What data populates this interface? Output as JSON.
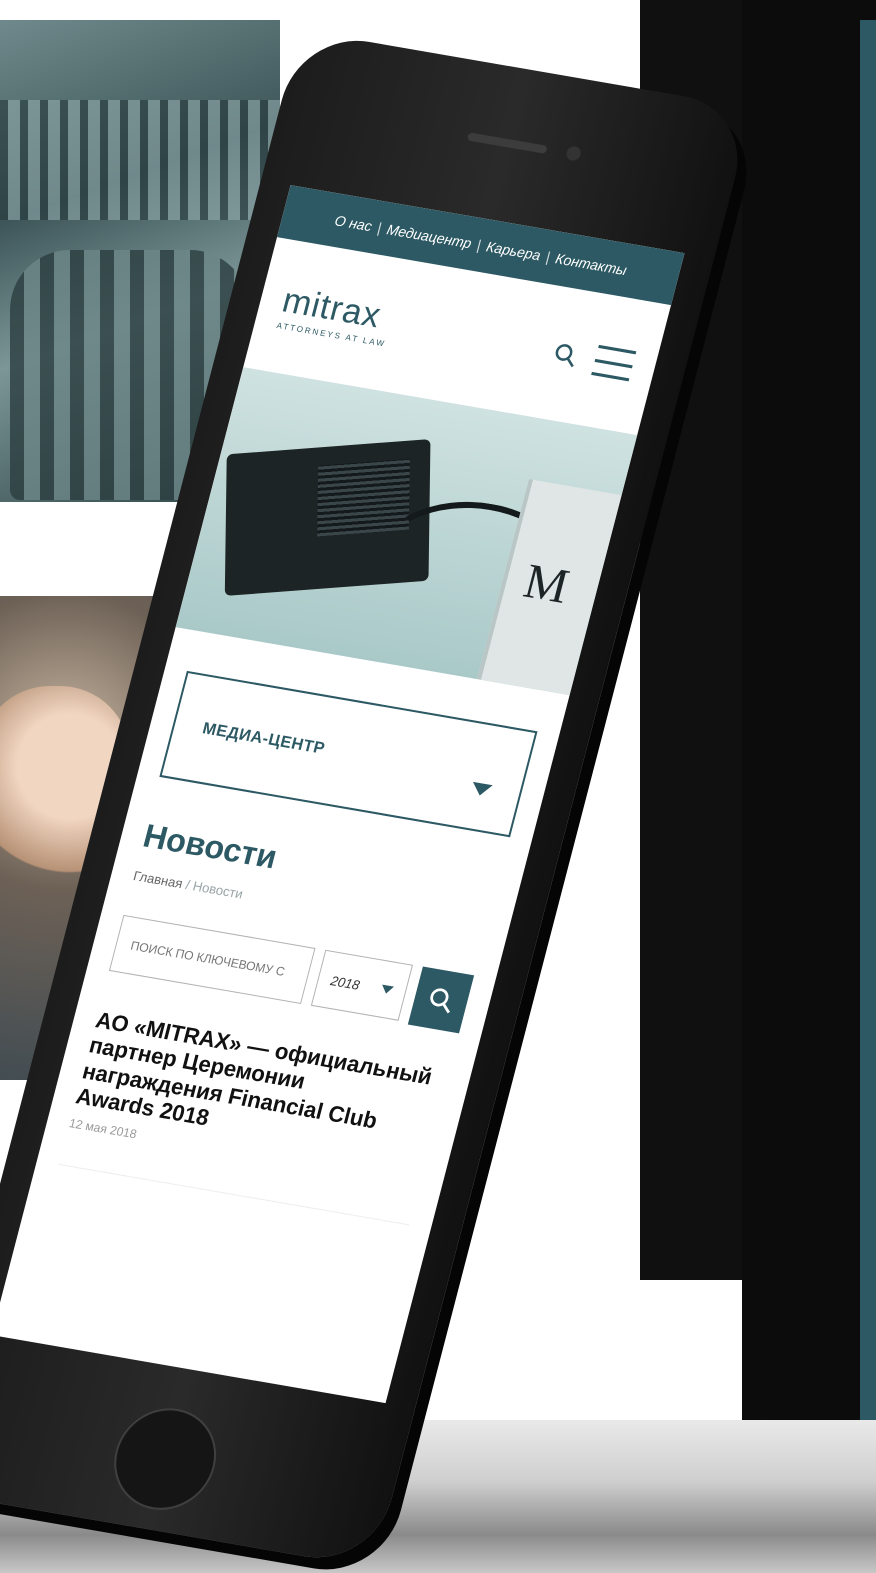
{
  "topnav": {
    "items": [
      "О нас",
      "Медиацентр",
      "Карьера",
      "Контакты"
    ],
    "separator": "|"
  },
  "logo": {
    "name": "mitrax",
    "tagline": "ATTORNEYS AT LAW"
  },
  "hero": {
    "book_letter": "M"
  },
  "dropdown": {
    "label": "МЕДИА-ЦЕНТР"
  },
  "page": {
    "title": "Новости",
    "breadcrumb_home": "Главная",
    "breadcrumb_sep": " / ",
    "breadcrumb_current": "Новости"
  },
  "search": {
    "placeholder": "ПОИСК ПО КЛЮЧЕВОМУ С",
    "year": "2018"
  },
  "news": [
    {
      "title": "АО «MITRAX» — официальный партнер Церемонии награждения Financial Club Awards 2018",
      "date": "12 мая 2018"
    }
  ],
  "colors": {
    "brand": "#2c5963",
    "phone_body": "#1c1c1c"
  }
}
